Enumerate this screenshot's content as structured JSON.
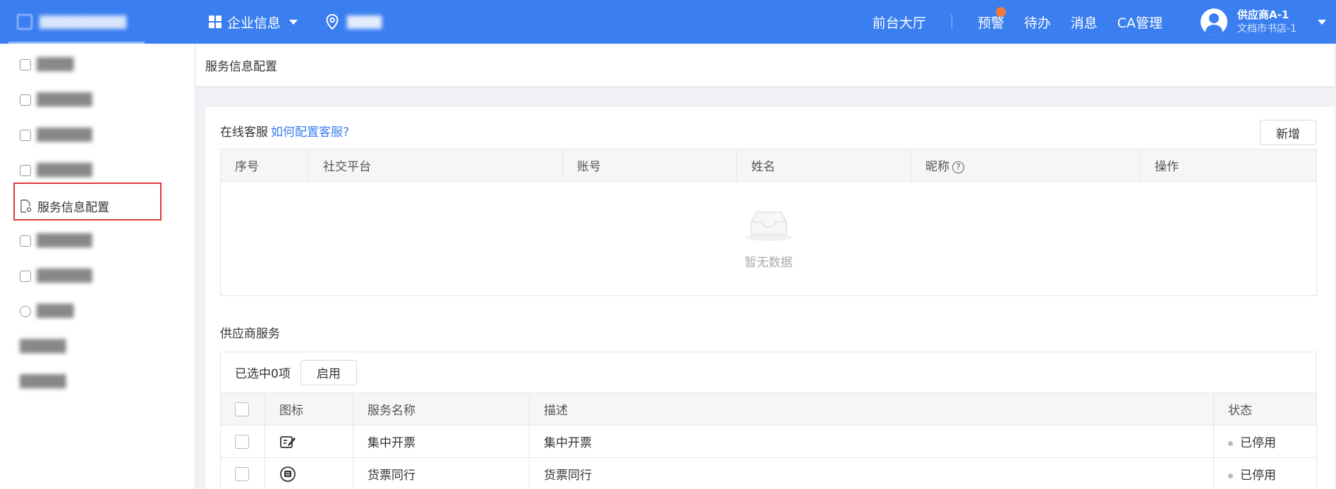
{
  "header": {
    "enterprise_label": "企业信息",
    "front_hall": "前台大厅",
    "warning": "预警",
    "todo": "待办",
    "messages": "消息",
    "ca_manage": "CA管理",
    "user_name": "供应商A-1",
    "user_shop": "文档市书店-1"
  },
  "sidebar": {
    "active_item": "服务信息配置"
  },
  "breadcrumb": "服务信息配置",
  "online_service": {
    "title": "在线客服",
    "help_link": "如何配置客服?",
    "add_button": "新增",
    "columns": [
      "序号",
      "社交平台",
      "账号",
      "姓名",
      "昵称",
      "操作"
    ],
    "empty_text": "暂无数据"
  },
  "supplier_service": {
    "title": "供应商服务",
    "selected_text": "已选中0项",
    "enable_button": "启用",
    "columns": [
      "图标",
      "服务名称",
      "描述",
      "状态"
    ],
    "rows": [
      {
        "icon": "invoice-edit-icon",
        "name": "集中开票",
        "desc": "集中开票",
        "status": "已停用"
      },
      {
        "icon": "ticket-circle-icon",
        "name": "货票同行",
        "desc": "货票同行",
        "status": "已停用"
      }
    ]
  }
}
